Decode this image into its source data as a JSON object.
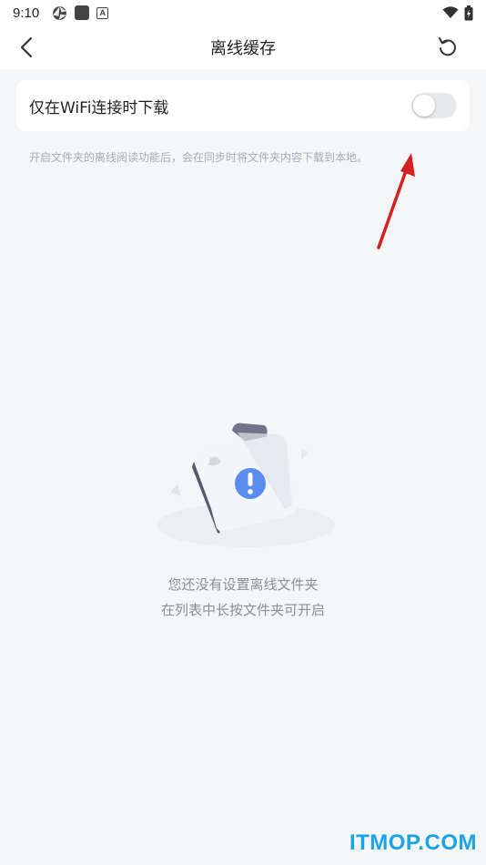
{
  "status_bar": {
    "time": "9:10",
    "icons": [
      "aperture-icon",
      "app-square-icon",
      "font-a-icon",
      "wifi-icon",
      "battery-icon"
    ]
  },
  "header": {
    "title": "离线缓存",
    "back_icon": "chevron-left-icon",
    "refresh_icon": "refresh-icon"
  },
  "settings": {
    "wifi_only_label": "仅在WiFi连接时下载",
    "wifi_only_enabled": false
  },
  "hint": "开启文件夹的离线阅读功能后，会在同步时将文件夹内容下载到本地。",
  "empty_state": {
    "icon": "folder-alert-icon",
    "line1": "您还没有设置离线文件夹",
    "line2": "在列表中长按文件夹可开启"
  },
  "watermark": "ITMOP.COM",
  "colors": {
    "background": "#f5f6f8",
    "alert_blue": "#5b8def",
    "toggle_off": "#e6e8ec",
    "annotation_red": "#d42020",
    "watermark": "#1aa3e8"
  }
}
